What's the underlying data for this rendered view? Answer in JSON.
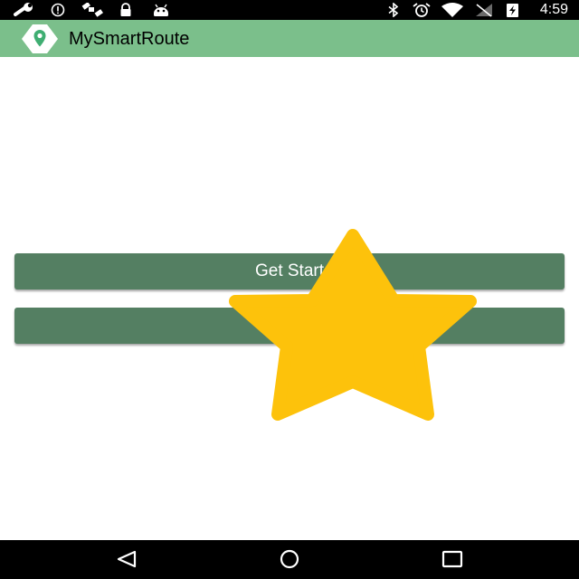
{
  "status_bar": {
    "icons": [
      "wrench-icon",
      "info-icon",
      "satellite-icon",
      "lock-icon",
      "android-icon",
      "bluetooth-icon",
      "alarm-icon",
      "wifi-icon",
      "no-signal-icon",
      "battery-charging-icon"
    ],
    "time": "4:59"
  },
  "app_bar": {
    "title": "MySmartRoute",
    "logo_icon": "map-pin-icon",
    "color": "#7bbf8b"
  },
  "main": {
    "buttons": [
      {
        "label": "Get Start"
      },
      {
        "label": ""
      }
    ],
    "button_color": "#547f62",
    "overlay_icon": "star-icon",
    "overlay_color": "#fdc20b"
  },
  "nav_bar": {
    "icons": [
      "back-icon",
      "home-icon",
      "recents-icon"
    ]
  }
}
